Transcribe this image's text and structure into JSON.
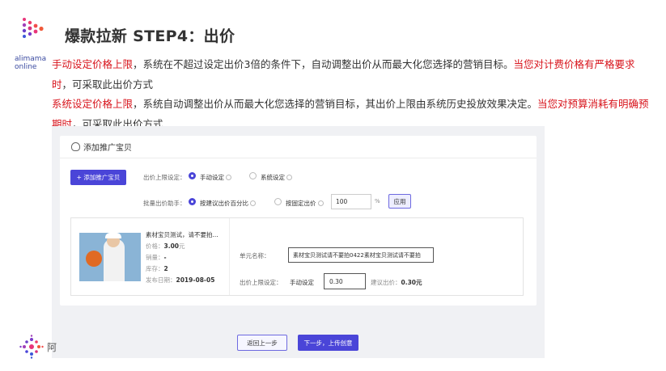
{
  "brand": {
    "line1": "alimama",
    "line2": "online"
  },
  "title": "爆款拉新 STEP4：出价",
  "description": {
    "p1_red1": "手动设定价格上限",
    "p1_text1": "，系统在不超过设定出价3倍的条件下，自动调整出价从而最大化您选择的营销目标。",
    "p1_red2": "当您对计费价格有严格要求时",
    "p1_text2": "，可采取此出价方式",
    "p2_red1": "系统设定价格上限",
    "p2_text1": "，系统自动调整出价从而最大化您选择的营销目标，其出价上限由系统历史投放效果决定。",
    "p2_red2": "当您对预算消耗有明确预期时",
    "p2_text2": "，可采取此出价方式"
  },
  "form": {
    "header": "添加推广宝贝",
    "add_button": "+ 添加推广宝贝",
    "bid_limit_label": "出价上限设定：",
    "bid_limit_options": [
      "手动设定",
      "系统设定"
    ],
    "bid_limit_selected": "手动设定",
    "batch_label": "批量出价助手：",
    "batch_options": [
      "按建议出价百分比",
      "按固定出价"
    ],
    "batch_selected": "按建议出价百分比",
    "percent_value": "100",
    "percent_sign": "%",
    "apply_button": "应用",
    "item": {
      "title": "素材宝贝测试，请不要拍...",
      "price_label": "价格：",
      "price_value": "3.00",
      "price_unit": "元",
      "sales_label": "销量：",
      "sales_value": "-",
      "stock_label": "库存：",
      "stock_value": "2",
      "date_label": "发布日期：",
      "date_value": "2019-08-05"
    },
    "unit_name_label": "单元名称：",
    "unit_name_value": "素材宝贝测试请不要拍0422素材宝贝测试请不要拍",
    "item_bid_label": "出价上限设定：",
    "item_bid_mode": "手动设定",
    "item_bid_value": "0.30",
    "suggest_label": "建议出价：",
    "suggest_value": "0.30元",
    "back_button": "返回上一步",
    "next_button": "下一步，上传创意"
  },
  "bottom_char": "阿",
  "colors": {
    "accent": "#4a45d8",
    "highlight_red": "#d8141c"
  }
}
